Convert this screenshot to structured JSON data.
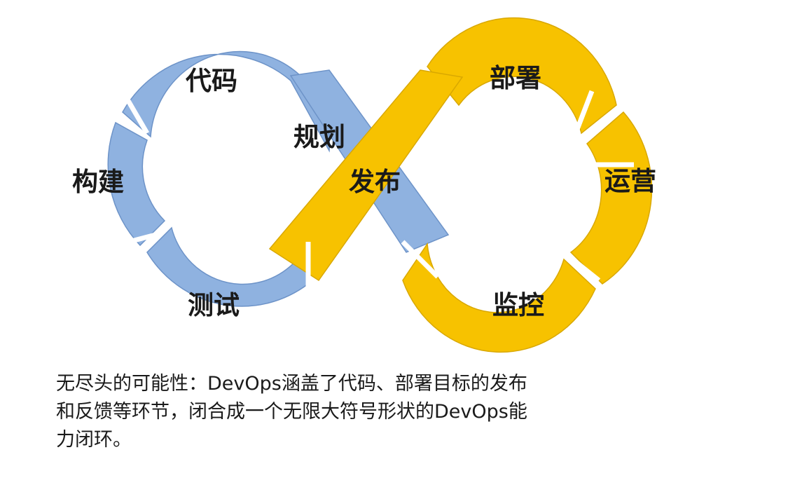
{
  "diagram": {
    "left_loop_color": "#8fb2e0",
    "left_loop_edge": "#6d93c8",
    "right_loop_color": "#f7c200",
    "right_loop_edge": "#d9a800",
    "stages": {
      "code": "代码",
      "plan": "规划",
      "build": "构建",
      "test": "测试",
      "release": "发布",
      "deploy": "部署",
      "operate": "运营",
      "monitor": "监控"
    }
  },
  "caption": {
    "line1": "无尽头的可能性：DevOps涵盖了代码、部署目标的发布",
    "line2": "和反馈等环节，闭合成一个无限大符号形状的DevOps能",
    "line3": "力闭环。"
  }
}
